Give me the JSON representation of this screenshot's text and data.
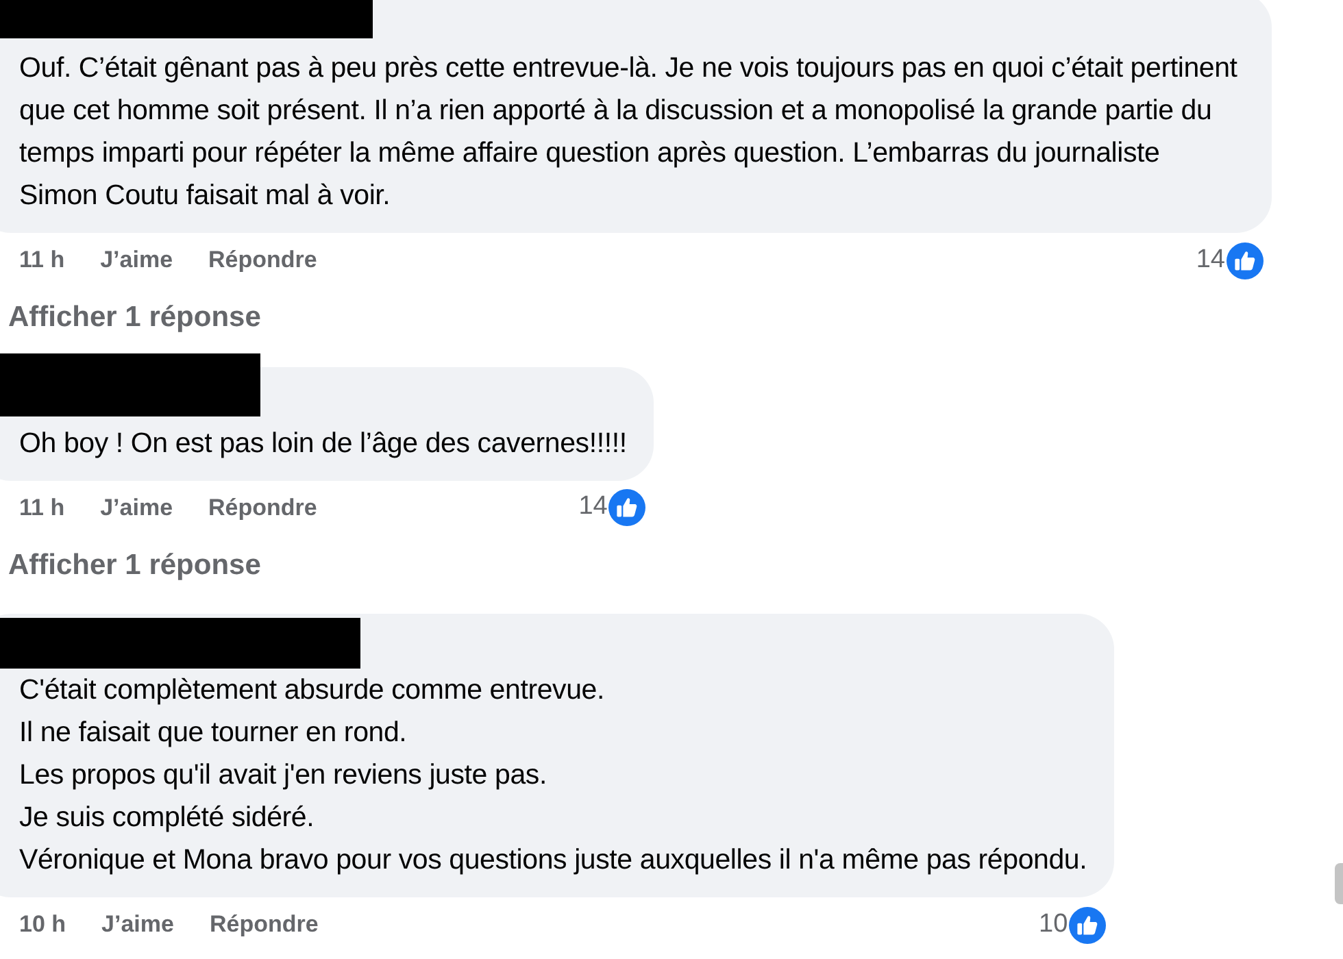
{
  "comments": [
    {
      "paragraphs": [
        "Ouf. C’était gênant pas à peu près cette entrevue-là. Je ne vois toujours pas en quoi c’était pertinent que cet homme soit présent. Il n’a rien apporté à la discussion et a monopolisé la grande partie du temps imparti pour répéter la même affaire question après question. L’embarras du journaliste Simon Coutu faisait mal à voir."
      ],
      "time": "11 h",
      "like_label": "J’aime",
      "reply_label": "Répondre",
      "reaction_count": "14",
      "replies_link": "Afficher 1 réponse"
    },
    {
      "paragraphs": [
        "Oh boy ! On est pas loin de l’âge des cavernes!!!!!"
      ],
      "time": "11 h",
      "like_label": "J’aime",
      "reply_label": "Répondre",
      "reaction_count": "14",
      "replies_link": "Afficher 1 réponse"
    },
    {
      "paragraphs": [
        "C'était complètement absurde comme entrevue.",
        "Il ne faisait que tourner en rond.",
        "Les propos qu'il avait j'en reviens juste pas.",
        "Je suis complété sidéré.",
        "Véronique et Mona bravo pour vos questions juste auxquelles il n'a même pas répondu."
      ],
      "time": "10 h",
      "like_label": "J’aime",
      "reply_label": "Répondre",
      "reaction_count": "10"
    }
  ]
}
